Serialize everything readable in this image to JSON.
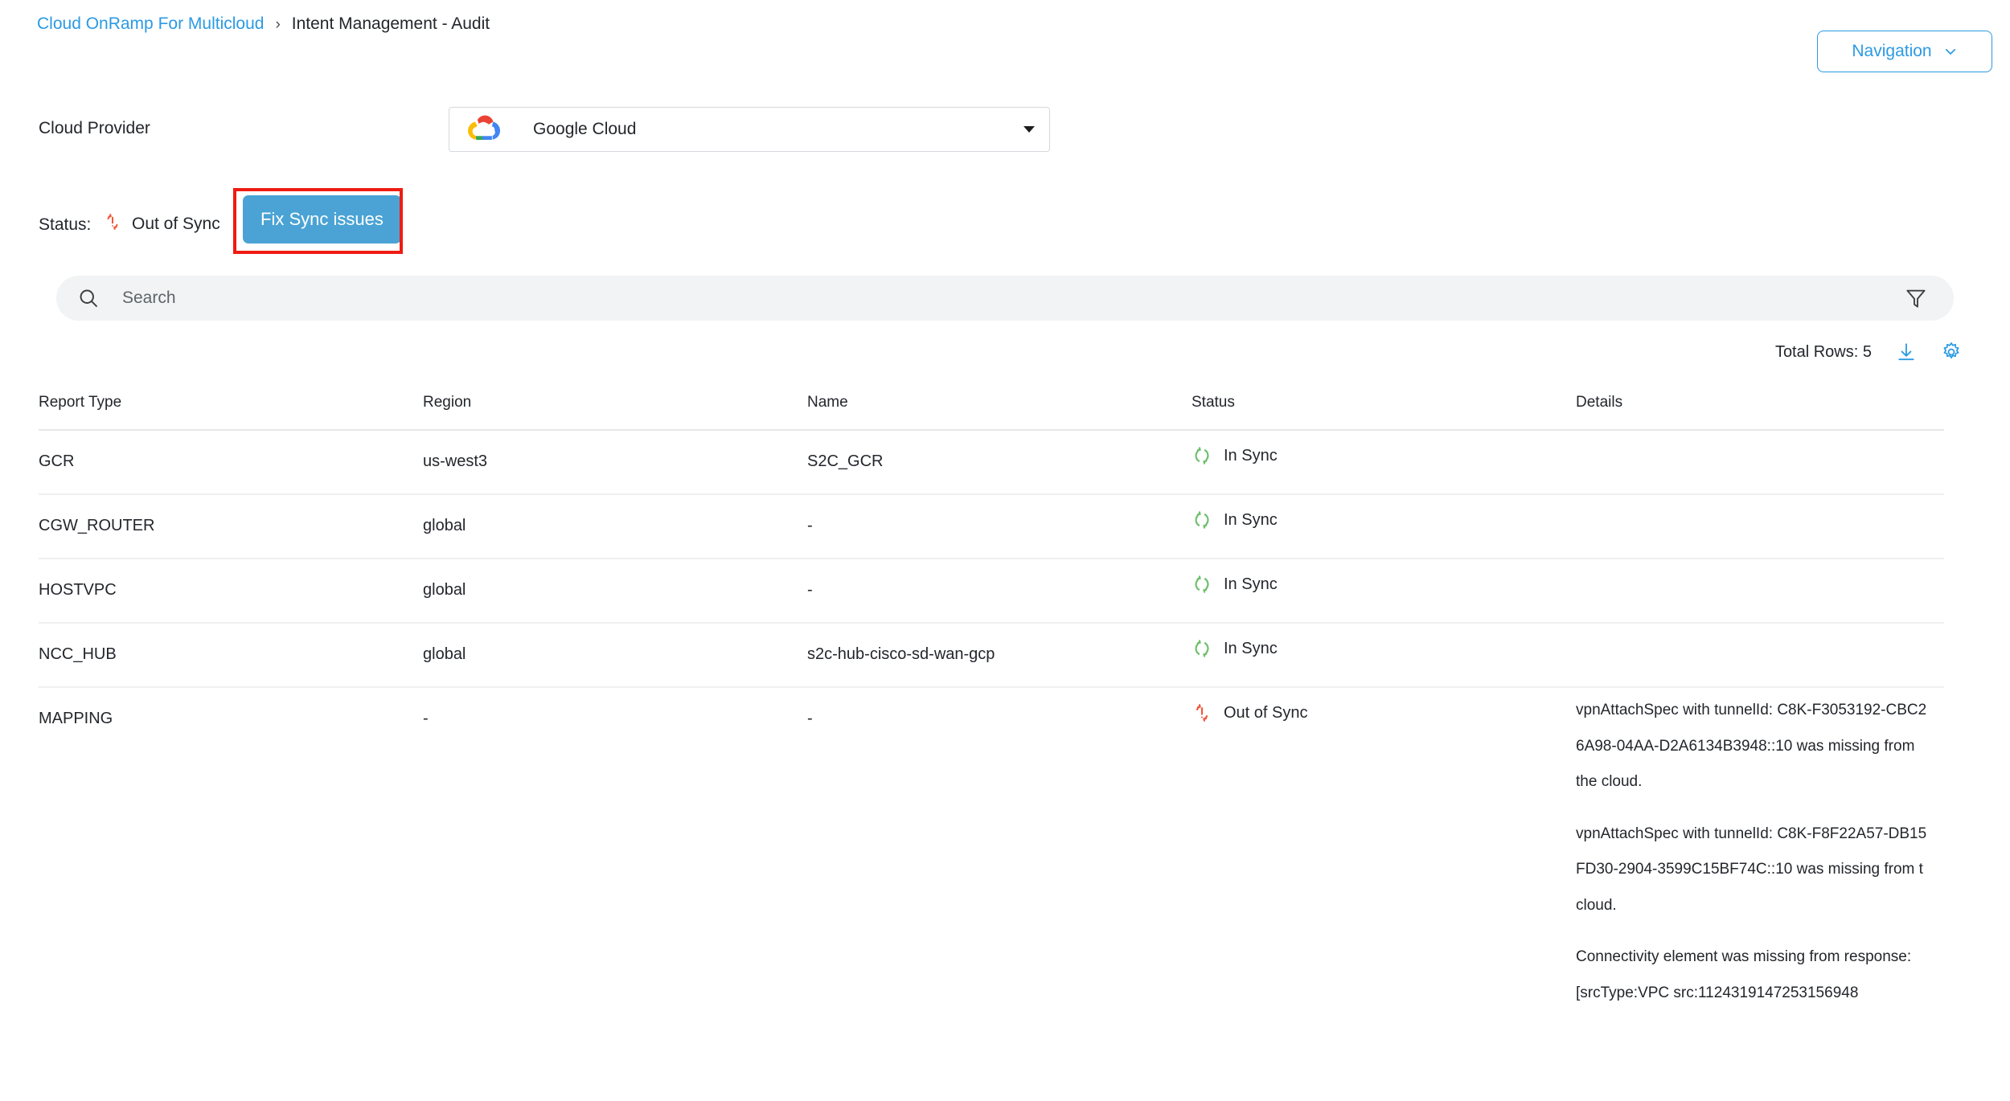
{
  "breadcrumb": {
    "root": "Cloud OnRamp For Multicloud",
    "separator": "›",
    "current": "Intent Management - Audit"
  },
  "header": {
    "navigation_label": "Navigation",
    "navigation_icon": "chevron-down-icon"
  },
  "cloud_provider": {
    "label": "Cloud Provider",
    "selected": "Google Cloud",
    "logo_icon": "google-cloud-logo",
    "caret_icon": "caret-down-icon"
  },
  "status_row": {
    "label": "Status:",
    "value": "Out of Sync",
    "value_icon": "out-of-sync-icon",
    "fix_button": "Fix Sync issues",
    "annotation_color": "#ee1c13"
  },
  "search": {
    "placeholder": "Search",
    "value": "",
    "search_icon": "search-icon",
    "filter_icon": "filter-icon"
  },
  "toolbar": {
    "total_rows": "Total Rows: 5",
    "download_icon": "download-icon",
    "settings_icon": "gear-icon"
  },
  "table": {
    "columns": [
      "Report Type",
      "Region",
      "Name",
      "Status",
      "Details"
    ],
    "rows": [
      {
        "report_type": "GCR",
        "region": "us-west3",
        "name": "S2C_GCR",
        "status": "In Sync",
        "status_icon": "in-sync-icon",
        "details": []
      },
      {
        "report_type": "CGW_ROUTER",
        "region": "global",
        "name": "-",
        "status": "In Sync",
        "status_icon": "in-sync-icon",
        "details": []
      },
      {
        "report_type": "HOSTVPC",
        "region": "global",
        "name": "-",
        "status": "In Sync",
        "status_icon": "in-sync-icon",
        "details": []
      },
      {
        "report_type": "NCC_HUB",
        "region": "global",
        "name": "s2c-hub-cisco-sd-wan-gcp",
        "status": "In Sync",
        "status_icon": "in-sync-icon",
        "details": []
      },
      {
        "report_type": "MAPPING",
        "region": "-",
        "name": "-",
        "status": "Out of Sync",
        "status_icon": "out-of-sync-icon",
        "details": [
          "vpnAttachSpec with tunnelId: C8K-F3053192-CBC2",
          "6A98-04AA-D2A6134B3948::10 was missing from",
          "the cloud.",
          "vpnAttachSpec with tunnelId: C8K-F8F22A57-DB15",
          "FD30-2904-3599C15BF74C::10 was missing from t",
          "cloud.",
          "Connectivity element was missing from response:",
          "[srcType:VPC src:1124319147253156948"
        ]
      }
    ]
  },
  "colors": {
    "link_blue": "#2b9ae3",
    "button_blue": "#4aa3d4",
    "in_sync_green": "#6dbf6b",
    "out_of_sync_red": "#f1553b",
    "annotation_red": "#ee1c13"
  }
}
